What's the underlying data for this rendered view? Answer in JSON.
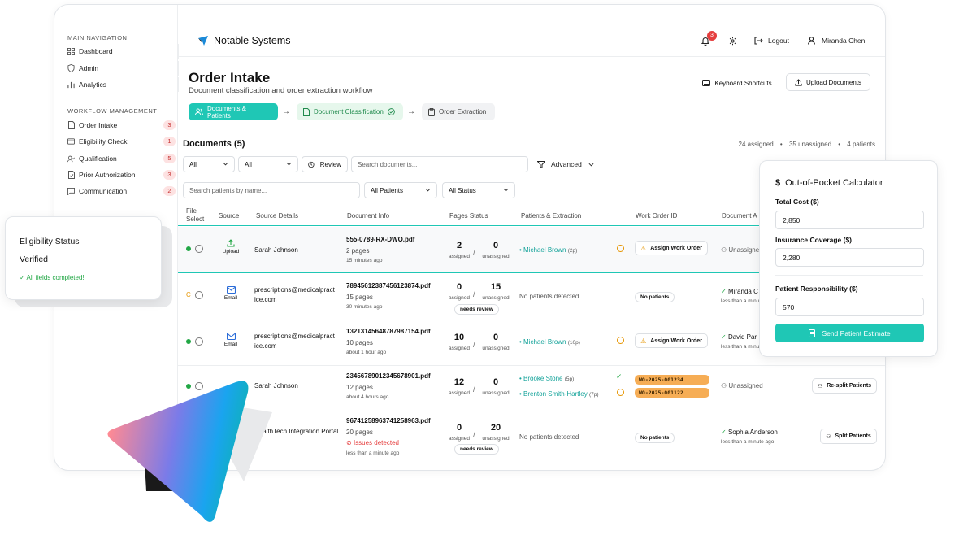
{
  "app": {
    "name": "Notable Systems"
  },
  "sidebar": {
    "main_title": "MAIN NAVIGATION",
    "main_items": [
      {
        "label": "Dashboard"
      },
      {
        "label": "Admin"
      },
      {
        "label": "Analytics"
      }
    ],
    "workflow_title": "WORKFLOW MANAGEMENT",
    "workflow_items": [
      {
        "label": "Order Intake",
        "count": "3"
      },
      {
        "label": "Eligibility Check",
        "count": "1"
      },
      {
        "label": "Qualification",
        "count": "5"
      },
      {
        "label": "Prior Authorization",
        "count": "3"
      },
      {
        "label": "Communication",
        "count": "2"
      }
    ]
  },
  "header": {
    "notifications": "3",
    "logout": "Logout",
    "user": "Miranda Chen"
  },
  "page": {
    "title": "Order Intake",
    "subtitle": "Document classification and order extraction workflow",
    "keyboard_shortcuts": "Keyboard Shortcuts",
    "upload_documents": "Upload Documents"
  },
  "steps": [
    {
      "label": "Documents & Patients"
    },
    {
      "label": "Document Classification"
    },
    {
      "label": "Order Extraction"
    }
  ],
  "documents": {
    "title": "Documents (5)",
    "stats": {
      "assigned": "24 assigned",
      "unassigned": "35 unassigned",
      "patients": "4 patients"
    },
    "filters": {
      "f1": "All",
      "f2": "All",
      "review": "Review",
      "search_placeholder": "Search documents...",
      "advanced": "Advanced",
      "patient_search_placeholder": "Search patients by name...",
      "all_patients": "All Patients",
      "all_status": "All Status"
    },
    "columns": {
      "file_select_1": "File",
      "file_select_2": "Select",
      "source": "Source",
      "source_details": "Source Details",
      "document_info": "Document Info",
      "pages_status": "Pages Status",
      "patients_extraction": "Patients & Extraction",
      "work_order_id": "Work Order ID",
      "document_assigned": "Document A"
    },
    "rows": [
      {
        "status": "C",
        "source": "Upload",
        "details": "Sarah Johnson",
        "doc": "555-0789-RX-DWO.pdf",
        "pages": "2 pages",
        "time": "15 minutes ago",
        "assigned": "2",
        "unassigned": "0",
        "patient": "Michael Brown",
        "patient_pages": "(2p)",
        "work_order": "Assign Work Order",
        "assignee": "Unassigned"
      },
      {
        "status": "C",
        "source": "Email",
        "details": "prescriptions@medicalpractice.com",
        "doc": "78945612387456123874.pdf",
        "pages": "15 pages",
        "time": "30 minutes ago",
        "assigned": "0",
        "unassigned": "15",
        "review": "needs review",
        "patient": "No patients detected",
        "work_order": "No patients",
        "assignee": "Miranda C",
        "assignee_time": "less than a minute"
      },
      {
        "status": "C",
        "source": "Email",
        "details": "prescriptions@medicalpractice.com",
        "doc": "13213145648787987154.pdf",
        "pages": "10 pages",
        "time": "about 1 hour ago",
        "assigned": "10",
        "unassigned": "0",
        "patient": "Michael Brown",
        "patient_pages": "(10p)",
        "work_order": "Assign Work Order",
        "assignee": "David Par",
        "assignee_time": "less than a minute"
      },
      {
        "status": "C",
        "source": "Upload",
        "details": "Sarah Johnson",
        "doc": "23456789012345678901.pdf",
        "pages": "12 pages",
        "time": "about 4 hours ago",
        "assigned": "12",
        "unassigned": "0",
        "patient": "Brooke Stone",
        "patient_pages": "(5p)",
        "patient2": "Brenton Smith-Hartley",
        "patient2_pages": "(7p)",
        "wo1": "WO-2025-001234",
        "wo2": "WO-2025-001122",
        "assignee": "Unassigned",
        "action": "Re-split Patients"
      },
      {
        "details": "HealthTech Integration Portal",
        "doc": "96741258963741258963.pdf",
        "pages": "20 pages",
        "issue": "Issues detected",
        "time": "less than a minute ago",
        "assigned": "0",
        "unassigned": "20",
        "review": "needs review",
        "patient": "No patients detected",
        "work_order": "No patients",
        "assignee": "Sophia Anderson",
        "assignee_time": "less than a minute ago",
        "action": "Split Patients"
      }
    ],
    "assigned_label": "assigned",
    "unassigned_label": "unassigned"
  },
  "eligibility": {
    "title": "Eligibility Status",
    "status": "Verified",
    "note": "All fields completed!"
  },
  "calculator": {
    "title": "Out-of-Pocket Calculator",
    "total_cost_label": "Total Cost ($)",
    "total_cost": "2,850",
    "insurance_label": "Insurance Coverage ($)",
    "insurance": "2,280",
    "responsibility_label": "Patient Responsibility ($)",
    "responsibility": "570",
    "send_button": "Send Patient Estimate"
  },
  "colors": {
    "teal": "#1fc7b5",
    "teal_text": "#14a39a",
    "badge_red": "#e53e3e",
    "orange": "#f6ad55"
  }
}
